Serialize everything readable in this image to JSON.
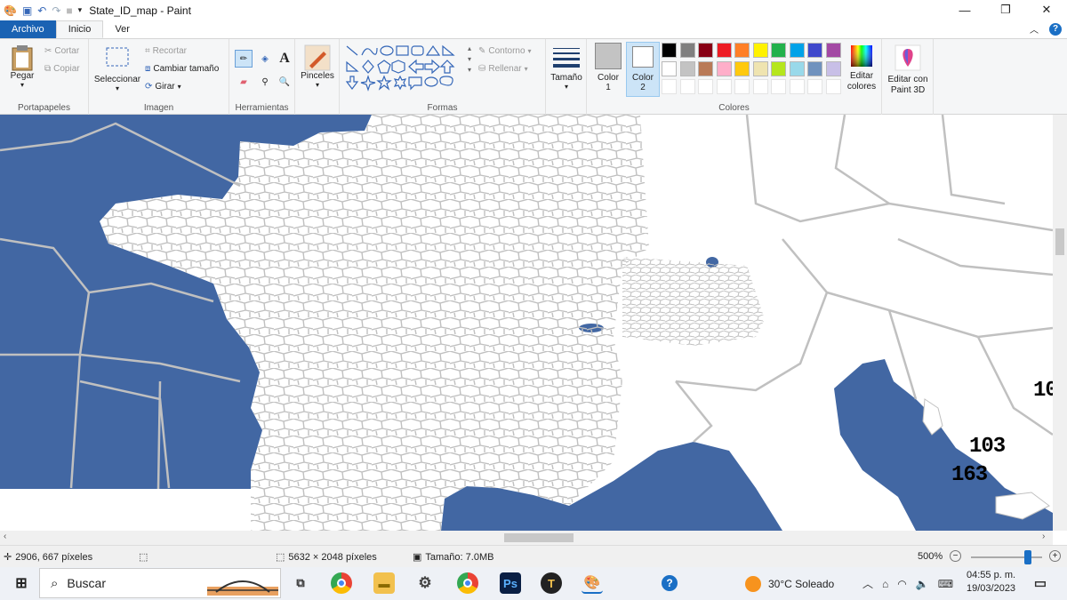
{
  "window": {
    "title": "State_ID_map - Paint"
  },
  "quick_access": {
    "icons": [
      "paint-app-icon",
      "save-icon",
      "undo-icon",
      "redo-icon",
      "customize-icon"
    ]
  },
  "tabs": {
    "file": "Archivo",
    "home": "Inicio",
    "view": "Ver"
  },
  "ribbon": {
    "clipboard": {
      "label": "Portapapeles",
      "paste": "Pegar",
      "cut": "Cortar",
      "copy": "Copiar"
    },
    "image": {
      "label": "Imagen",
      "select": "Seleccionar",
      "crop": "Recortar",
      "resize": "Cambiar tamaño",
      "rotate": "Girar"
    },
    "tools": {
      "label": "Herramientas"
    },
    "brushes": {
      "label": "Pinceles"
    },
    "shapes": {
      "label": "Formas",
      "outline": "Contorno",
      "fill": "Rellenar"
    },
    "size": {
      "label": "Tamaño"
    },
    "colors": {
      "label": "Colores",
      "color1": "Color",
      "color1_num": "1",
      "color2": "Color",
      "color2_num": "2",
      "edit": "Editar colores",
      "color1_value": "#c3c3c3",
      "color2_value": "#ffffff",
      "palette_row1": [
        "#000000",
        "#7f7f7f",
        "#880015",
        "#ed1c24",
        "#ff7f27",
        "#fff200",
        "#22b14c",
        "#00a2e8",
        "#3f48cc",
        "#a349a4"
      ],
      "palette_row2": [
        "#ffffff",
        "#c3c3c3",
        "#b97a57",
        "#ffaec9",
        "#ffc90e",
        "#efe4b0",
        "#b5e61d",
        "#99d9ea",
        "#7092be",
        "#c8bfe7"
      ]
    },
    "paint3d": {
      "label": "Editar con Paint 3D"
    }
  },
  "map": {
    "labels": [
      "10",
      "103",
      "163"
    ],
    "water_color": "#4267a3",
    "border_color": "#c0c0c0"
  },
  "status": {
    "cursor": "2906, 667 píxeles",
    "dimensions": "5632 × 2048 píxeles",
    "size": "Tamaño: 7.0MB",
    "zoom": "500%",
    "zoom_fraction": 0.8
  },
  "taskbar": {
    "search": "Buscar",
    "weather": "30°C  Soleado",
    "time": "04:55 p. m.",
    "date": "19/03/2023"
  }
}
